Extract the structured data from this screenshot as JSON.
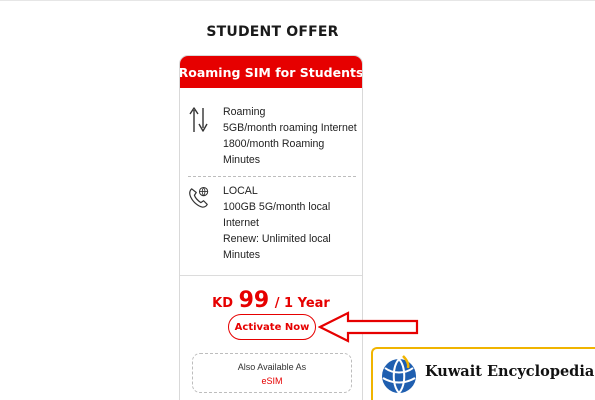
{
  "section": {
    "title": "STUDENT OFFER"
  },
  "card": {
    "header": "Roaming SIM for Students",
    "features": [
      {
        "icon": "roaming-arrows-icon",
        "lines": [
          "Roaming",
          "5GB/month roaming Internet",
          "1800/month Roaming",
          "Minutes"
        ]
      },
      {
        "icon": "phone-globe-icon",
        "lines": [
          "LOCAL",
          "100GB 5G/month local",
          "Internet",
          "Renew: Unlimited local",
          "Minutes"
        ]
      }
    ],
    "price": {
      "currency": "KD",
      "amount": "99",
      "period": "/ 1 Year"
    },
    "activate_label": "Activate Now",
    "also": {
      "label": "Also Available As",
      "link": "eSIM"
    }
  },
  "watermark": {
    "text": "Kuwait Encyclopedia"
  },
  "colors": {
    "brand_red": "#e60000",
    "watermark_border": "#f0b400"
  }
}
